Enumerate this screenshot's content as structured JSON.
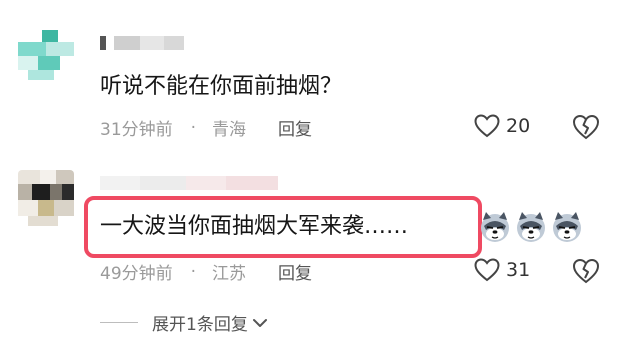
{
  "comments": [
    {
      "text": "听说不能在你面前抽烟？",
      "time": "31分钟前",
      "separator": "·",
      "location": "青海",
      "reply_label": "回复",
      "like_count": "20"
    },
    {
      "text": "一大波当你面抽烟大军来袭……",
      "time": "49分钟前",
      "separator": "·",
      "location": "江苏",
      "reply_label": "回复",
      "like_count": "31",
      "emoji_icons": [
        "husky-dog-emoji-icon",
        "husky-dog-emoji-icon",
        "husky-dog-emoji-icon"
      ]
    }
  ],
  "expand_replies": {
    "label": "展开1条回复"
  },
  "colors": {
    "highlight_border": "#ef4a62",
    "meta_text": "#9a9a9a",
    "body_text": "#161616"
  }
}
